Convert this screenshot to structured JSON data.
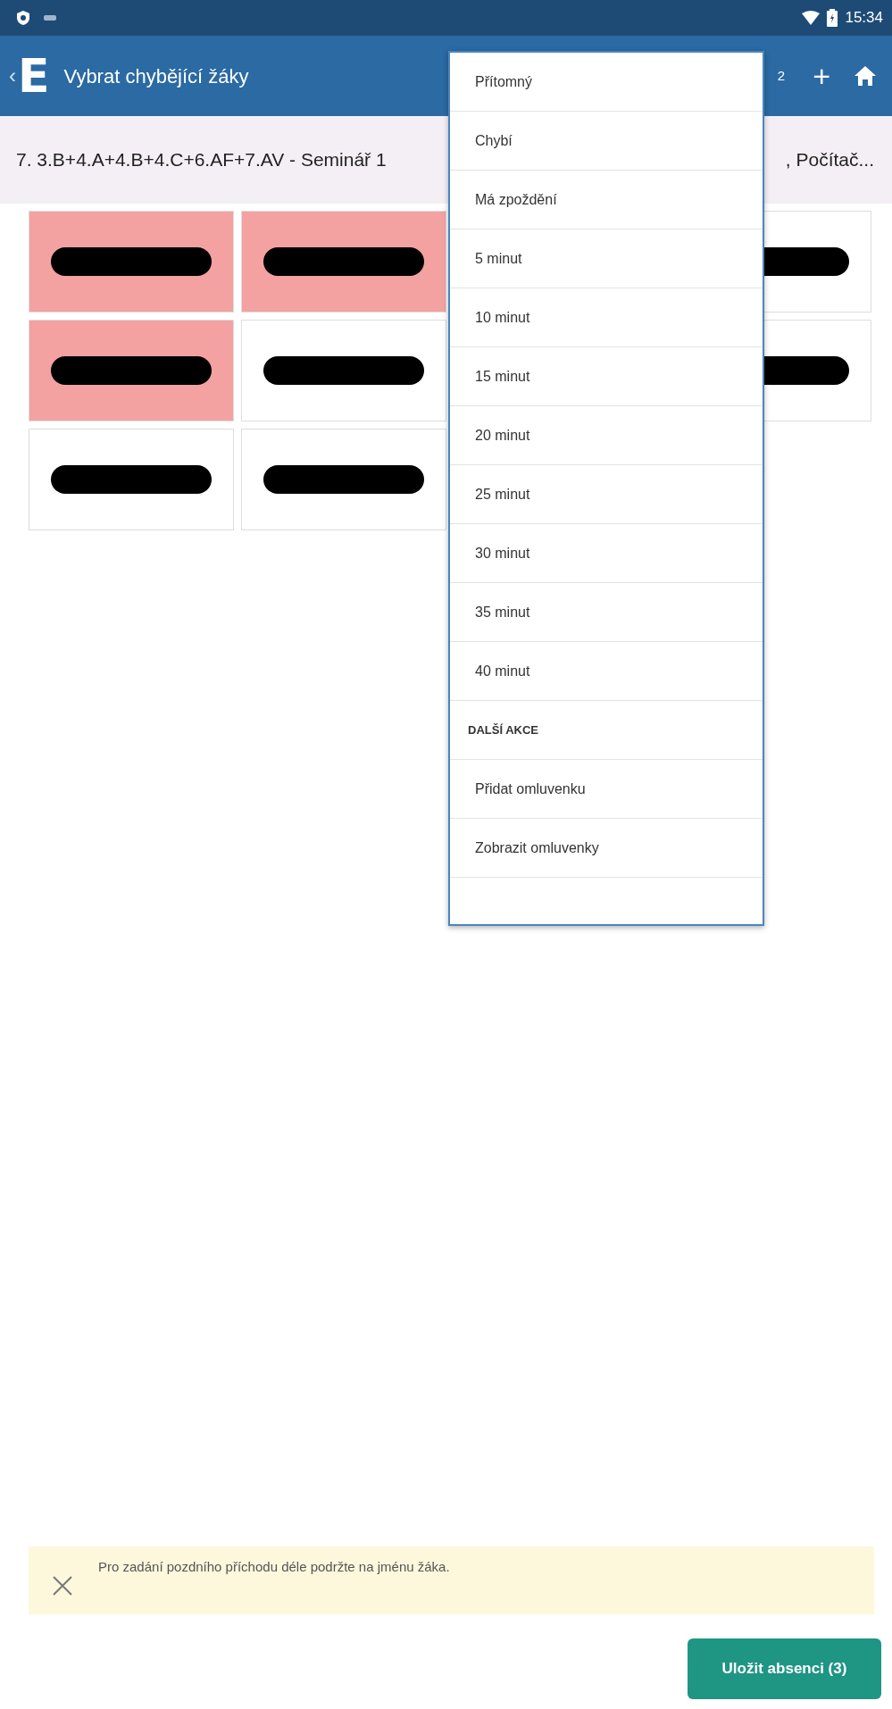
{
  "status_bar": {
    "time": "15:34"
  },
  "app_bar": {
    "back": "‹",
    "logo": "E",
    "title": "Vybrat chybějící žáky",
    "partial_action": "2",
    "add": "+"
  },
  "lesson": {
    "text": "7.  3.B+4.A+4.B+4.C+6.AF+7.AV - Seminář 1",
    "text_right": ", Počítač..."
  },
  "grid": {
    "rows": [
      {
        "cells": [
          {
            "absent": true
          },
          {
            "absent": true
          },
          {
            "absent": false
          }
        ]
      },
      {
        "cells": [
          {
            "absent": true
          },
          {
            "absent": false
          },
          {
            "absent": false
          }
        ]
      },
      {
        "cells": [
          {
            "absent": false
          },
          {
            "absent": false
          }
        ]
      }
    ]
  },
  "menu": {
    "items": [
      {
        "kind": "item",
        "label": "Přítomný"
      },
      {
        "kind": "item",
        "label": "Chybí"
      },
      {
        "kind": "item",
        "label": "Má zpoždění"
      },
      {
        "kind": "item",
        "label": "5 minut"
      },
      {
        "kind": "item",
        "label": "10 minut"
      },
      {
        "kind": "item",
        "label": "15 minut"
      },
      {
        "kind": "item",
        "label": "20 minut"
      },
      {
        "kind": "item",
        "label": "25 minut"
      },
      {
        "kind": "item",
        "label": "30 minut"
      },
      {
        "kind": "item",
        "label": "35 minut"
      },
      {
        "kind": "item",
        "label": "40 minut"
      },
      {
        "kind": "header",
        "label": "DALŠÍ AKCE"
      },
      {
        "kind": "item",
        "label": "Přidat omluvenku"
      },
      {
        "kind": "item",
        "label": "Zobrazit omluvenky"
      },
      {
        "kind": "blank"
      }
    ]
  },
  "hint": {
    "text": "Pro zadání pozdního příchodu déle podržte na jménu žáka."
  },
  "save_button": {
    "label": "Uložit absenci (3)"
  }
}
